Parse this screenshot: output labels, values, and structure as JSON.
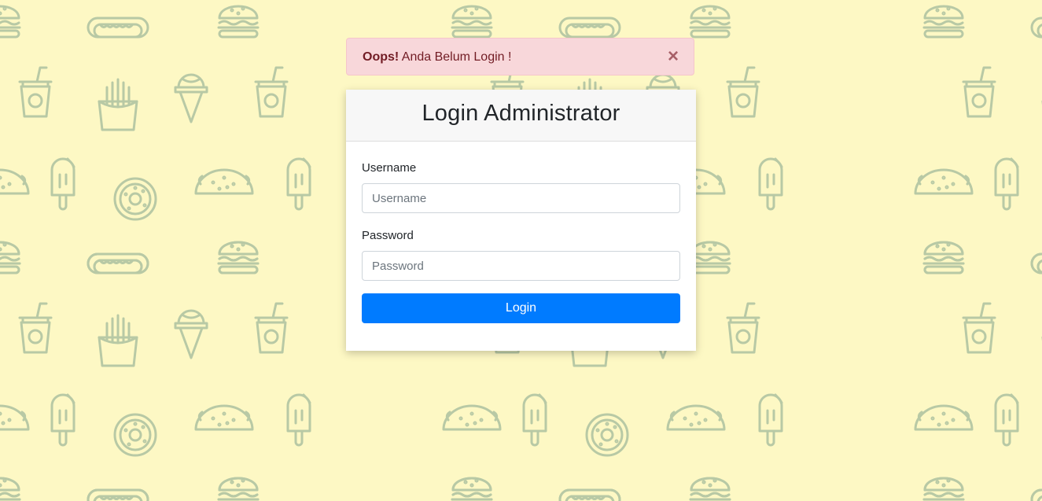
{
  "alert": {
    "strong": "Oops!",
    "message": " Anda Belum Login !",
    "close_symbol": "×"
  },
  "form": {
    "title": "Login Administrator",
    "username_label": "Username",
    "username_placeholder": "Username",
    "username_value": "",
    "password_label": "Password",
    "password_placeholder": "Password",
    "password_value": "",
    "submit_label": "Login"
  },
  "colors": {
    "background": "#fdf8c4",
    "pattern_stroke": "#b8c9a5",
    "alert_bg": "#f8d7da",
    "alert_text": "#721c24",
    "button": "#007bff"
  },
  "background_icons": [
    "burger-icon",
    "hotdog-icon",
    "soda-cup-icon",
    "fries-icon",
    "ice-cream-cone-icon",
    "popsicle-icon",
    "donut-icon",
    "taco-icon"
  ]
}
